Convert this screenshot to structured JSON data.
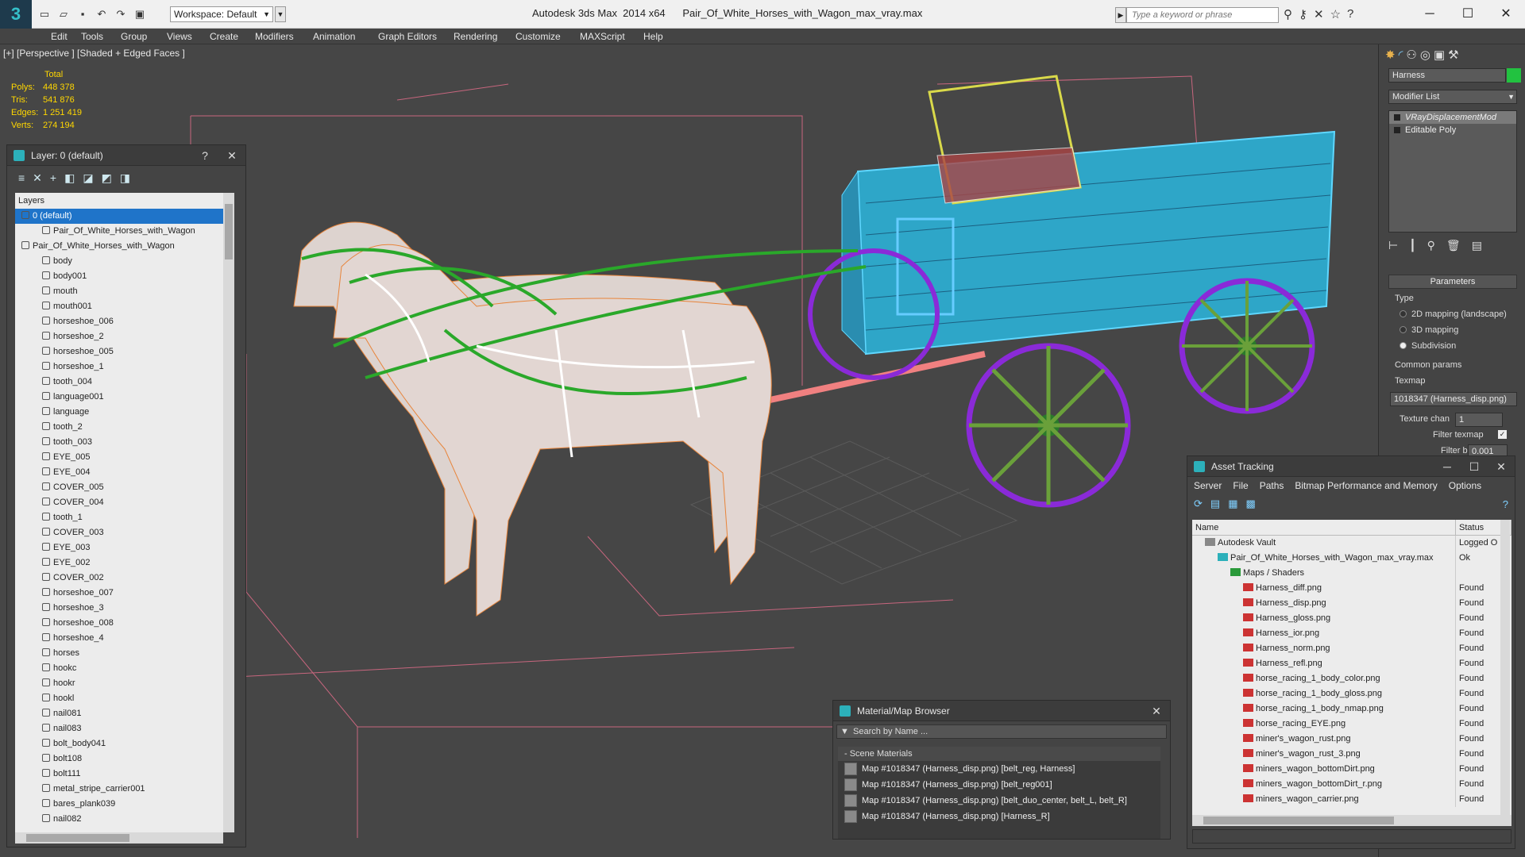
{
  "app": {
    "logo_glyph": "3",
    "workspace": "Workspace: Default",
    "title": "Autodesk 3ds Max  2014 x64      Pair_Of_White_Horses_with_Wagon_max_vray.max",
    "search_placeholder": "Type a keyword or phrase",
    "menu": [
      "Edit",
      "Tools",
      "Group",
      "Views",
      "Create",
      "Modifiers",
      "Animation",
      "Graph Editors",
      "Rendering",
      "Customize",
      "MAXScript",
      "Help"
    ]
  },
  "viewport": {
    "label": "[+] [Perspective ] [Shaded + Edged Faces ]",
    "stats": {
      "header": "Total",
      "rows": [
        {
          "k": "Polys:",
          "v": "448 378"
        },
        {
          "k": "Tris:",
          "v": "541 876"
        },
        {
          "k": "Edges:",
          "v": "1 251 419"
        },
        {
          "k": "Verts:",
          "v": "274 194"
        }
      ]
    }
  },
  "layer_panel": {
    "title": "Layer: 0 (default)",
    "help": "?",
    "column": "Layers",
    "rows": [
      {
        "label": "0 (default)",
        "indent": 1,
        "selected": true
      },
      {
        "label": "Pair_Of_White_Horses_with_Wagon",
        "indent": 2
      },
      {
        "label": "Pair_Of_White_Horses_with_Wagon",
        "indent": 1
      },
      {
        "label": "body",
        "indent": 2
      },
      {
        "label": "body001",
        "indent": 2
      },
      {
        "label": "mouth",
        "indent": 2
      },
      {
        "label": "mouth001",
        "indent": 2
      },
      {
        "label": "horseshoe_006",
        "indent": 2
      },
      {
        "label": "horseshoe_2",
        "indent": 2
      },
      {
        "label": "horseshoe_005",
        "indent": 2
      },
      {
        "label": "horseshoe_1",
        "indent": 2
      },
      {
        "label": "tooth_004",
        "indent": 2
      },
      {
        "label": "language001",
        "indent": 2
      },
      {
        "label": "language",
        "indent": 2
      },
      {
        "label": "tooth_2",
        "indent": 2
      },
      {
        "label": "tooth_003",
        "indent": 2
      },
      {
        "label": "EYE_005",
        "indent": 2
      },
      {
        "label": "EYE_004",
        "indent": 2
      },
      {
        "label": "COVER_005",
        "indent": 2
      },
      {
        "label": "COVER_004",
        "indent": 2
      },
      {
        "label": "tooth_1",
        "indent": 2
      },
      {
        "label": "COVER_003",
        "indent": 2
      },
      {
        "label": "EYE_003",
        "indent": 2
      },
      {
        "label": "EYE_002",
        "indent": 2
      },
      {
        "label": "COVER_002",
        "indent": 2
      },
      {
        "label": "horseshoe_007",
        "indent": 2
      },
      {
        "label": "horseshoe_3",
        "indent": 2
      },
      {
        "label": "horseshoe_008",
        "indent": 2
      },
      {
        "label": "horseshoe_4",
        "indent": 2
      },
      {
        "label": "horses",
        "indent": 2
      },
      {
        "label": "hookc",
        "indent": 2
      },
      {
        "label": "hookr",
        "indent": 2
      },
      {
        "label": "hookl",
        "indent": 2
      },
      {
        "label": "nail081",
        "indent": 2
      },
      {
        "label": "nail083",
        "indent": 2
      },
      {
        "label": "bolt_body041",
        "indent": 2
      },
      {
        "label": "bolt108",
        "indent": 2
      },
      {
        "label": "bolt111",
        "indent": 2
      },
      {
        "label": "metal_stripe_carrier001",
        "indent": 2
      },
      {
        "label": "bares_plank039",
        "indent": 2
      },
      {
        "label": "nail082",
        "indent": 2
      }
    ]
  },
  "command_panel": {
    "object_name": "Harness",
    "modifier_list": "Modifier List",
    "stack": [
      "VRayDisplacementMod",
      "Editable Poly"
    ],
    "parameters": "Parameters",
    "type_label": "Type",
    "types": [
      {
        "label": "2D mapping (landscape)",
        "on": false
      },
      {
        "label": "3D mapping",
        "on": false
      },
      {
        "label": "Subdivision",
        "on": true
      }
    ],
    "common_params": "Common params",
    "texmap_label": "Texmap",
    "texmap_value": "1018347 (Harness_disp.png)",
    "texture_chan_label": "Texture chan",
    "texture_chan_value": "1",
    "filter_texmap": "Filter texmap",
    "filter_blur_label": "Filter blur",
    "filter_blur_value": "0.001"
  },
  "asset_tracking": {
    "title": "Asset Tracking",
    "menu": [
      "Server",
      "File",
      "Paths",
      "Bitmap Performance and Memory",
      "Options"
    ],
    "col_name": "Name",
    "col_status": "Status",
    "rows": [
      {
        "name": "Autodesk Vault",
        "status": "Logged O",
        "indent": 1,
        "icon": "vault"
      },
      {
        "name": "Pair_Of_White_Horses_with_Wagon_max_vray.max",
        "status": "Ok",
        "indent": 2,
        "icon": "max"
      },
      {
        "name": "Maps / Shaders",
        "status": "",
        "indent": 3,
        "icon": "folder"
      },
      {
        "name": "Harness_diff.png",
        "status": "Found",
        "indent": 4,
        "icon": "png"
      },
      {
        "name": "Harness_disp.png",
        "status": "Found",
        "indent": 4,
        "icon": "png"
      },
      {
        "name": "Harness_gloss.png",
        "status": "Found",
        "indent": 4,
        "icon": "png"
      },
      {
        "name": "Harness_ior.png",
        "status": "Found",
        "indent": 4,
        "icon": "png"
      },
      {
        "name": "Harness_norm.png",
        "status": "Found",
        "indent": 4,
        "icon": "png"
      },
      {
        "name": "Harness_refl.png",
        "status": "Found",
        "indent": 4,
        "icon": "png"
      },
      {
        "name": "horse_racing_1_body_color.png",
        "status": "Found",
        "indent": 4,
        "icon": "png"
      },
      {
        "name": "horse_racing_1_body_gloss.png",
        "status": "Found",
        "indent": 4,
        "icon": "png"
      },
      {
        "name": "horse_racing_1_body_nmap.png",
        "status": "Found",
        "indent": 4,
        "icon": "png"
      },
      {
        "name": "horse_racing_EYE.png",
        "status": "Found",
        "indent": 4,
        "icon": "png"
      },
      {
        "name": "miner's_wagon_rust.png",
        "status": "Found",
        "indent": 4,
        "icon": "png"
      },
      {
        "name": "miner's_wagon_rust_3.png",
        "status": "Found",
        "indent": 4,
        "icon": "png"
      },
      {
        "name": "miners_wagon_bottomDirt.png",
        "status": "Found",
        "indent": 4,
        "icon": "png"
      },
      {
        "name": "miners_wagon_bottomDirt_r.png",
        "status": "Found",
        "indent": 4,
        "icon": "png"
      },
      {
        "name": "miners_wagon_carrier.png",
        "status": "Found",
        "indent": 4,
        "icon": "png"
      }
    ]
  },
  "material_browser": {
    "title": "Material/Map Browser",
    "search_placeholder": "Search by Name ...",
    "group": "- Scene Materials",
    "items": [
      "Map #1018347 (Harness_disp.png) [belt_reg, Harness]",
      "Map #1018347 (Harness_disp.png) [belt_reg001]",
      "Map #1018347 (Harness_disp.png) [belt_duo_center, belt_L, belt_R]",
      "Map #1018347 (Harness_disp.png) [Harness_R]"
    ]
  }
}
